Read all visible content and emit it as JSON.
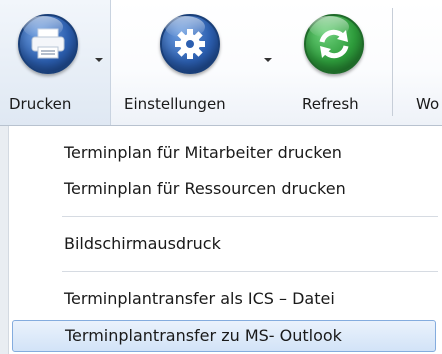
{
  "ribbon": {
    "buttons": [
      {
        "label": "Drucken",
        "icon": "printer-icon",
        "color": "#2c5fb0"
      },
      {
        "label": "Einstellungen",
        "icon": "gear-icon",
        "color": "#2c5fb0"
      },
      {
        "label": "Refresh",
        "icon": "refresh-icon",
        "color": "#2e9d3c"
      },
      {
        "label": "Wo"
      }
    ]
  },
  "menu": {
    "items": [
      {
        "label": "Terminplan für Mitarbeiter drucken"
      },
      {
        "label": "Terminplan für Ressourcen drucken"
      },
      {
        "label": "Bildschirmausdruck"
      },
      {
        "label": "Terminplantransfer als ICS – Datei"
      },
      {
        "label": "Terminplantransfer zu MS- Outlook"
      }
    ],
    "highlighted_index": 4
  }
}
